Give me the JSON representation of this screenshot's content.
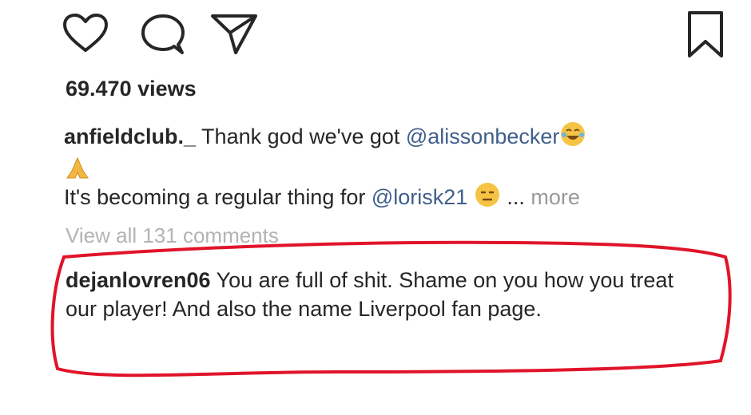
{
  "actions": {
    "like_icon": "heart-outline",
    "comment_icon": "speech-bubble",
    "share_icon": "paper-plane",
    "save_icon": "bookmark"
  },
  "post": {
    "views": "69.470 views",
    "caption": {
      "username": "anfieldclub._",
      "text_before": " Thank god we've got ",
      "mention_1": "@alissonbecker",
      "line2_text": "It's becoming a regular thing for ",
      "mention_2": "@lorisk21",
      "ellipsis": " ... ",
      "more_label": "more"
    },
    "view_all_comments": "View all 131 comments"
  },
  "comment": {
    "username": "dejanlovren06",
    "text": " You are full of shit. Shame on you how you treat our player! And also the name Liverpool fan page."
  },
  "colors": {
    "mention": "#3f5f8a",
    "muted": "#999999",
    "highlight_outline": "#e0142a"
  }
}
